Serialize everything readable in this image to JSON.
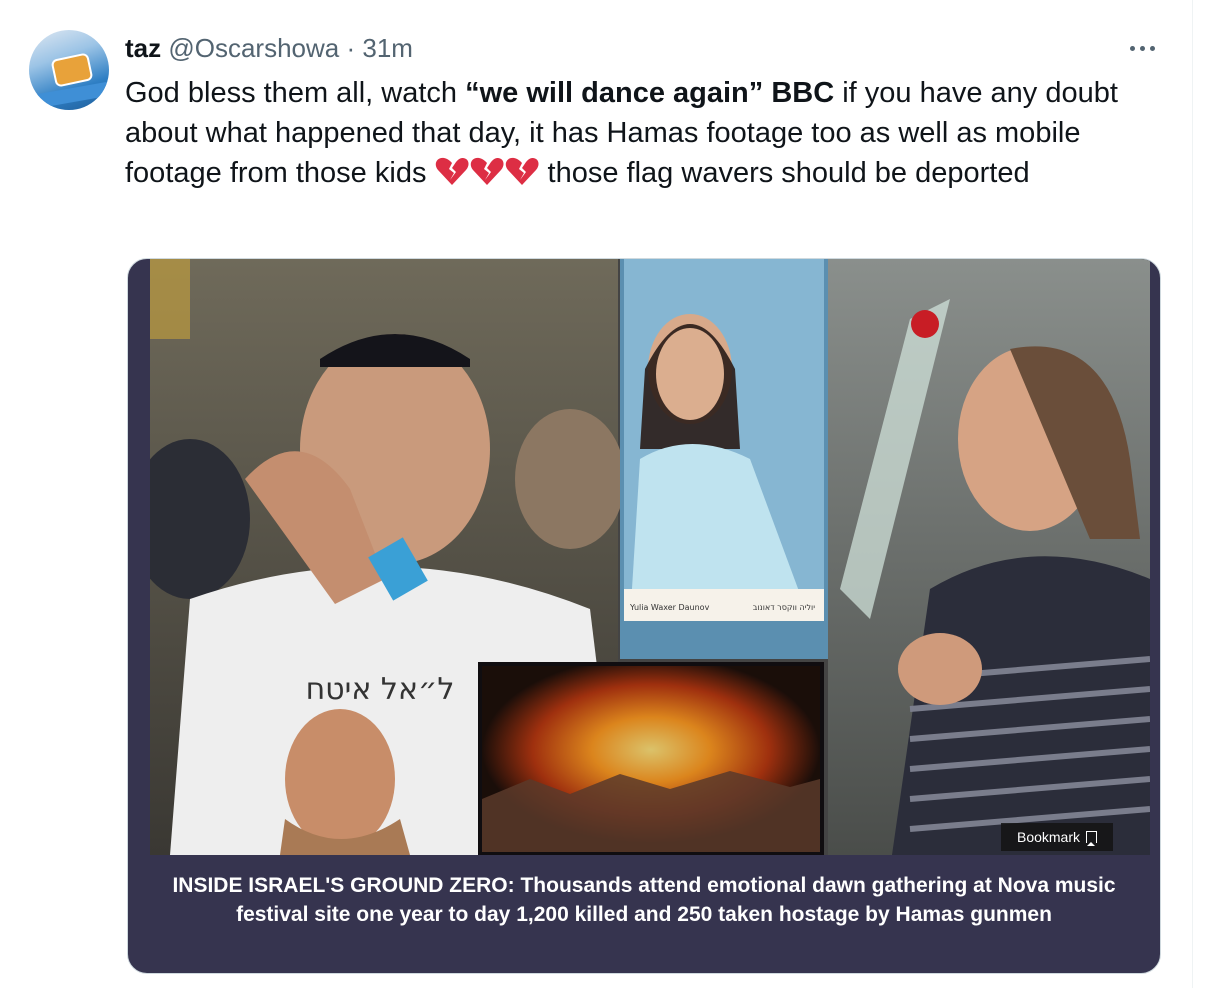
{
  "tweet": {
    "display_name": "taz",
    "handle": "@Oscarshowa",
    "separator": " · ",
    "time": "31m",
    "text": {
      "part1": "God bless them all, watch ",
      "bold1": "“we will dance again”",
      "part2": " ",
      "bold2": "BBC",
      "part3": " if you have any doubt about what happened that day, it has Hamas footage too as well as mobile footage from those kids ",
      "part4": " those flag wavers should be deported"
    },
    "emoji": "broken-heart-icon",
    "emoji_count": 3
  },
  "card": {
    "caption": "INSIDE ISRAEL'S GROUND ZERO: Thousands attend emotional dawn gathering at Nova music festival site one year to day 1,200 killed and 250 taken hostage by Hamas gunmen",
    "bookmark_label": "Bookmark",
    "image_texts": {
      "shirt_text": "ל״אל איטח",
      "portrait_name_en": "Yulia Waxer Daunov",
      "portrait_name_he": "יוליה ווקסר דאונוב"
    }
  },
  "colors": {
    "text": "#0f1419",
    "secondary": "#536471",
    "card_bg": "#36344f",
    "card_border": "#cfd9de"
  }
}
